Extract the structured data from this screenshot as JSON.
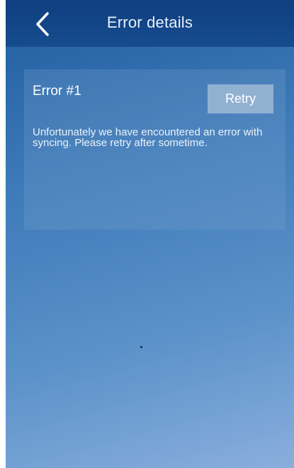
{
  "header": {
    "title": "Error details",
    "back_icon": "chevron-left-icon"
  },
  "error_card": {
    "title": "Error #1",
    "retry_label": "Retry",
    "message": "Unfortunately we have encountered an error with syncing. Please retry after sometime."
  },
  "colors": {
    "header_bg": "#164c8f",
    "background_top": "#1f5c9f",
    "background_bottom": "#8aaedd",
    "retry_button": "#91b1d1",
    "text": "#ffffff"
  }
}
